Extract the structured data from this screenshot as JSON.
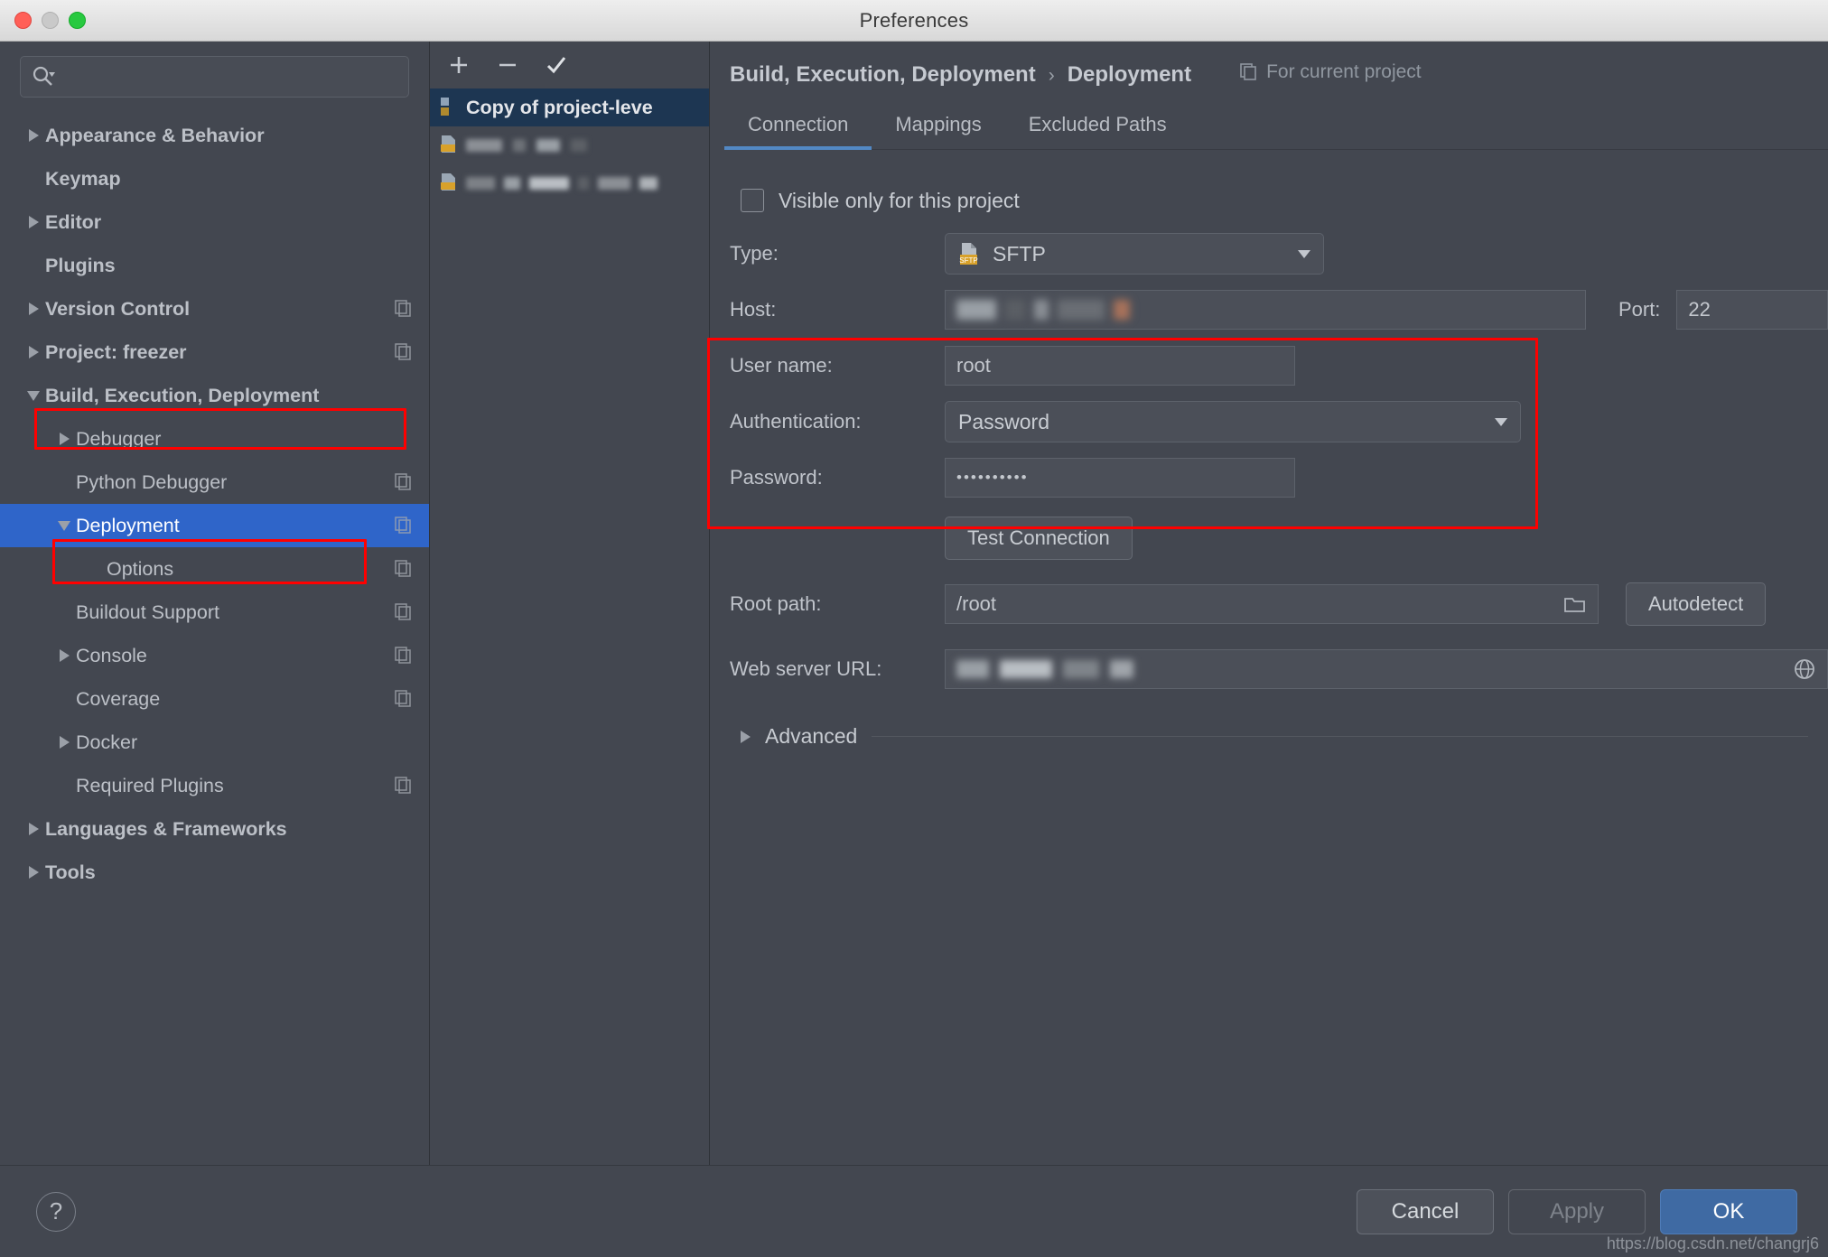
{
  "window": {
    "title": "Preferences"
  },
  "search": {
    "placeholder": "",
    "icon": "search-icon"
  },
  "sidebar": {
    "items": [
      {
        "label": "Appearance & Behavior",
        "level": 0,
        "arrow": "right",
        "bold": true,
        "copy": false,
        "selected": false
      },
      {
        "label": "Keymap",
        "level": 0,
        "arrow": "none",
        "bold": true,
        "copy": false,
        "selected": false
      },
      {
        "label": "Editor",
        "level": 0,
        "arrow": "right",
        "bold": true,
        "copy": false,
        "selected": false
      },
      {
        "label": "Plugins",
        "level": 0,
        "arrow": "none",
        "bold": true,
        "copy": false,
        "selected": false
      },
      {
        "label": "Version Control",
        "level": 0,
        "arrow": "right",
        "bold": true,
        "copy": true,
        "selected": false
      },
      {
        "label": "Project: freezer",
        "level": 0,
        "arrow": "right",
        "bold": true,
        "copy": true,
        "selected": false
      },
      {
        "label": "Build, Execution, Deployment",
        "level": 0,
        "arrow": "down",
        "bold": true,
        "copy": false,
        "selected": false,
        "highlight": true
      },
      {
        "label": "Debugger",
        "level": 1,
        "arrow": "right",
        "bold": false,
        "copy": false,
        "selected": false
      },
      {
        "label": "Python Debugger",
        "level": 1,
        "arrow": "none",
        "bold": false,
        "copy": true,
        "selected": false
      },
      {
        "label": "Deployment",
        "level": 1,
        "arrow": "down",
        "bold": false,
        "copy": true,
        "selected": true,
        "highlight": true
      },
      {
        "label": "Options",
        "level": 2,
        "arrow": "none",
        "bold": false,
        "copy": true,
        "selected": false
      },
      {
        "label": "Buildout Support",
        "level": 1,
        "arrow": "none",
        "bold": false,
        "copy": true,
        "selected": false
      },
      {
        "label": "Console",
        "level": 1,
        "arrow": "right",
        "bold": false,
        "copy": true,
        "selected": false
      },
      {
        "label": "Coverage",
        "level": 1,
        "arrow": "none",
        "bold": false,
        "copy": true,
        "selected": false
      },
      {
        "label": "Docker",
        "level": 1,
        "arrow": "right",
        "bold": false,
        "copy": false,
        "selected": false
      },
      {
        "label": "Required Plugins",
        "level": 1,
        "arrow": "none",
        "bold": false,
        "copy": true,
        "selected": false
      },
      {
        "label": "Languages & Frameworks",
        "level": 0,
        "arrow": "right",
        "bold": true,
        "copy": false,
        "selected": false
      },
      {
        "label": "Tools",
        "level": 0,
        "arrow": "right",
        "bold": true,
        "copy": false,
        "selected": false
      }
    ]
  },
  "server_list": {
    "toolbar": {
      "add": "+",
      "remove": "−",
      "confirm": "✓"
    },
    "items": [
      {
        "label": "Copy of project-leve",
        "selected": true,
        "redacted": false
      },
      {
        "label": "",
        "selected": false,
        "redacted": true
      },
      {
        "label": "",
        "selected": false,
        "redacted": true
      }
    ]
  },
  "main": {
    "breadcrumb": {
      "parent": "Build, Execution, Deployment",
      "separator": "›",
      "current": "Deployment"
    },
    "for_current_project": "For current project",
    "tabs": [
      {
        "label": "Connection",
        "active": true
      },
      {
        "label": "Mappings",
        "active": false
      },
      {
        "label": "Excluded Paths",
        "active": false
      }
    ],
    "visible_only": {
      "label": "Visible only for this project",
      "checked": false
    },
    "fields": {
      "type_label": "Type:",
      "type_value": "SFTP",
      "type_badge": "SFTP",
      "host_label": "Host:",
      "host_value": "",
      "port_label": "Port:",
      "port_value": "22",
      "username_label": "User name:",
      "username_value": "root",
      "auth_label": "Authentication:",
      "auth_value": "Password",
      "password_label": "Password:",
      "password_value": "••••••••••",
      "root_path_label": "Root path:",
      "root_path_value": "/root",
      "web_url_label": "Web server URL:",
      "web_url_value": ""
    },
    "test_connection": "Test Connection",
    "autodetect": "Autodetect",
    "advanced": "Advanced"
  },
  "footer": {
    "help": "?",
    "cancel": "Cancel",
    "apply": "Apply",
    "ok": "OK",
    "watermark": "https://blog.csdn.net/changrj6"
  },
  "colors": {
    "selection_blue": "#2f65c9",
    "highlight_red": "#ff0000",
    "tab_underline": "#5288c4",
    "ok_button": "#3f6aa3",
    "sftp_badge": "#d8a12a"
  }
}
